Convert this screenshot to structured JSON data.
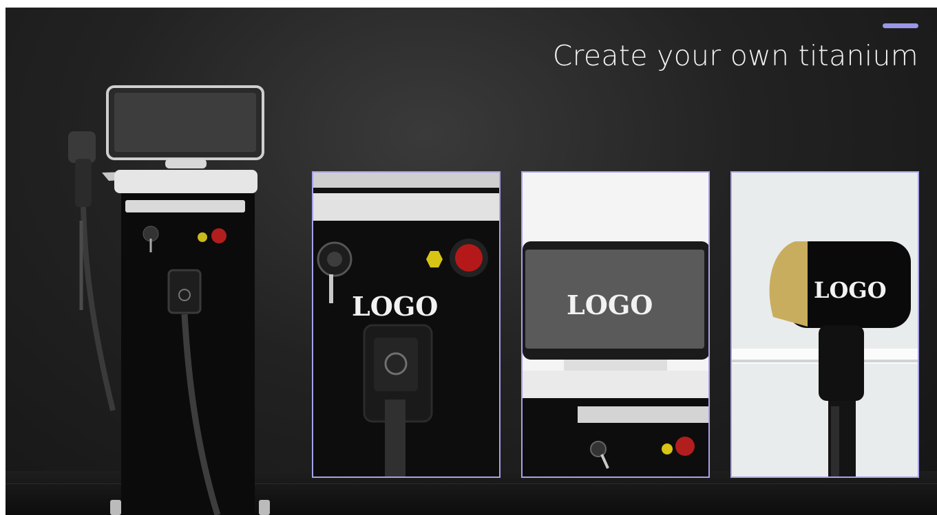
{
  "colors": {
    "accent": "#9a97e8",
    "panel_border": "#a7a3ea",
    "background": "#1c1c1c"
  },
  "headline": "Create your own titanium",
  "panels": [
    {
      "logo": "LOGO"
    },
    {
      "logo": "LOGO"
    },
    {
      "logo": "LOGO"
    }
  ]
}
